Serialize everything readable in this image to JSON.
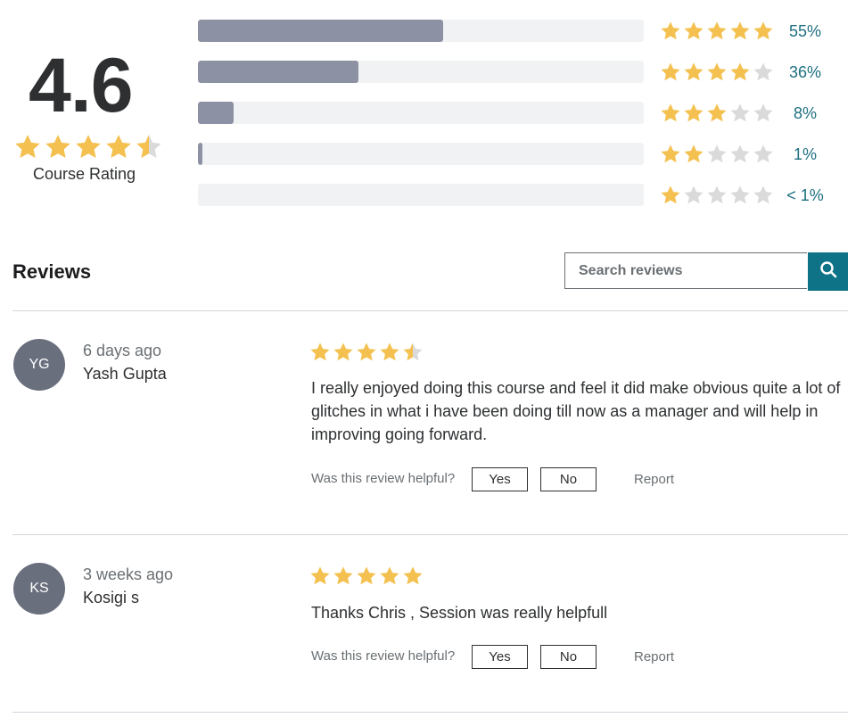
{
  "summary": {
    "average": "4.6",
    "average_stars": 4.5,
    "label": "Course Rating"
  },
  "breakdown": [
    {
      "stars": 5,
      "percent_label": "55%",
      "fill": 0.55
    },
    {
      "stars": 4,
      "percent_label": "36%",
      "fill": 0.36
    },
    {
      "stars": 3,
      "percent_label": "8%",
      "fill": 0.08
    },
    {
      "stars": 2,
      "percent_label": "1%",
      "fill": 0.01
    },
    {
      "stars": 1,
      "percent_label": "< 1%",
      "fill": 0.0
    }
  ],
  "reviews_section": {
    "title": "Reviews",
    "search_placeholder": "Search reviews",
    "search_icon": "search-icon"
  },
  "reviews": [
    {
      "initials": "YG",
      "time": "6 days ago",
      "author": "Yash Gupta",
      "rating": 4.5,
      "text": "I really enjoyed doing this course and feel it did make obvious quite a lot of glitches in what i have been doing till now as a manager and will help in improving going forward.",
      "helpful_label": "Was this review helpful?",
      "yes_label": "Yes",
      "no_label": "No",
      "report_label": "Report"
    },
    {
      "initials": "KS",
      "time": "3 weeks ago",
      "author": "Kosigi s",
      "rating": 5,
      "text": "Thanks Chris , Session was really helpfull",
      "helpful_label": "Was this review helpful?",
      "yes_label": "Yes",
      "no_label": "No",
      "report_label": "Report"
    }
  ],
  "colors": {
    "star_filled": "#f4c150",
    "star_empty": "#dadada",
    "bar_fill": "#8c92a3",
    "bar_track": "#f1f2f4",
    "percent_text": "#1e6f80",
    "search_button": "#0f7387",
    "avatar_bg": "#6a6f7e"
  }
}
